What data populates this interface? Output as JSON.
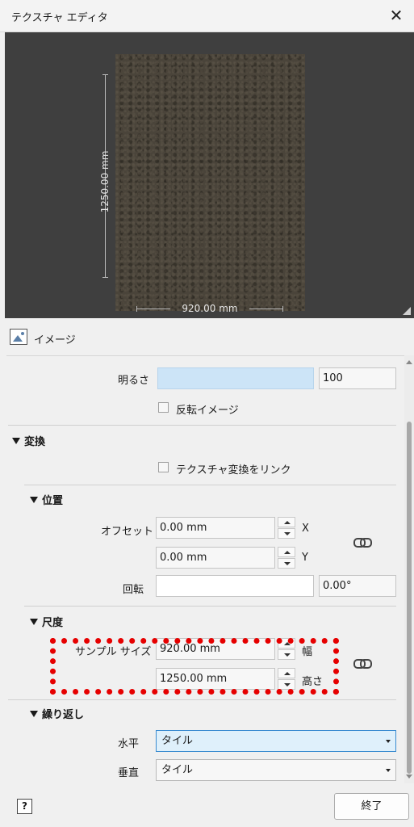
{
  "window": {
    "title": "テクスチャ エディタ"
  },
  "preview": {
    "height_label": "1250.00 mm",
    "width_label": "920.00 mm"
  },
  "image_section": {
    "label": "イメージ"
  },
  "brightness": {
    "label": "明るさ",
    "value": "100"
  },
  "invert": {
    "label": "反転イメージ",
    "checked": false
  },
  "transform": {
    "title": "変換",
    "link_label": "テクスチャ変換をリンク",
    "link_checked": false
  },
  "position": {
    "title": "位置",
    "offset_label": "オフセット",
    "offset_x": "0.00 mm",
    "x_label": "X",
    "offset_y": "0.00 mm",
    "y_label": "Y",
    "rotation_label": "回転",
    "rotation_value": "0.00°"
  },
  "scale": {
    "title": "尺度",
    "sample_size_label": "サンプル サイズ",
    "width_value": "920.00 mm",
    "width_label": "幅",
    "height_value": "1250.00 mm",
    "height_label": "高さ"
  },
  "repeat": {
    "title": "繰り返し",
    "horizontal_label": "水平",
    "horizontal_value": "タイル",
    "vertical_label": "垂直",
    "vertical_value": "タイル"
  },
  "footer": {
    "help": "?",
    "done": "終了"
  },
  "colors": {
    "highlight": "#e60000",
    "accent": "#cce4f7",
    "preview_bg": "#3f3f3f"
  }
}
